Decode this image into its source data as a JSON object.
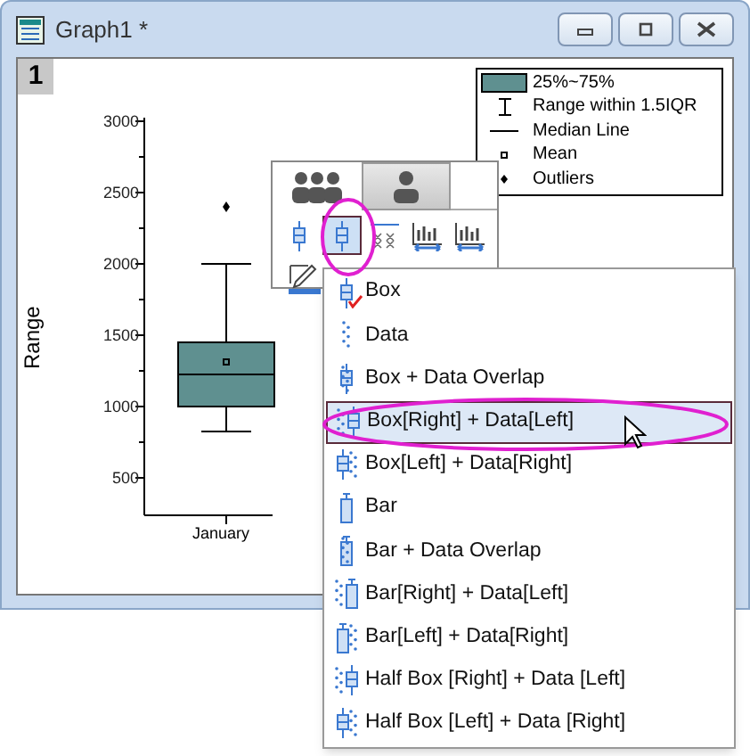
{
  "window": {
    "title": "Graph1 *"
  },
  "layer": {
    "label": "1"
  },
  "plot": {
    "ylabel": "Range",
    "yticks": [
      "3000",
      "2500",
      "2000",
      "1500",
      "1000",
      "500"
    ],
    "category": "January"
  },
  "legend": [
    "25%~75%",
    "Range within 1.5IQR",
    "Median Line",
    "Mean",
    "Outliers"
  ],
  "panel": {
    "tabs": [
      {
        "selected": true
      },
      {
        "selected": false
      }
    ],
    "tools": [
      {
        "selected": false
      },
      {
        "selected": true
      },
      {
        "selected": false
      },
      {
        "selected": false
      },
      {
        "selected": false
      }
    ]
  },
  "menu": [
    {
      "label": "Box",
      "checked": true,
      "selected": false
    },
    {
      "label": "Data",
      "checked": false,
      "selected": false
    },
    {
      "label": "Box + Data Overlap",
      "checked": false,
      "selected": false
    },
    {
      "label": "Box[Right] + Data[Left]",
      "checked": false,
      "selected": true
    },
    {
      "label": "Box[Left] + Data[Right]",
      "checked": false,
      "selected": false
    },
    {
      "label": "Bar",
      "checked": false,
      "selected": false
    },
    {
      "label": "Bar + Data Overlap",
      "checked": false,
      "selected": false
    },
    {
      "label": "Bar[Right] + Data[Left]",
      "checked": false,
      "selected": false
    },
    {
      "label": "Bar[Left] + Data[Right]",
      "checked": false,
      "selected": false
    },
    {
      "label": "Half Box [Right] + Data [Left]",
      "checked": false,
      "selected": false
    },
    {
      "label": "Half Box [Left] + Data [Right]",
      "checked": false,
      "selected": false
    }
  ]
}
